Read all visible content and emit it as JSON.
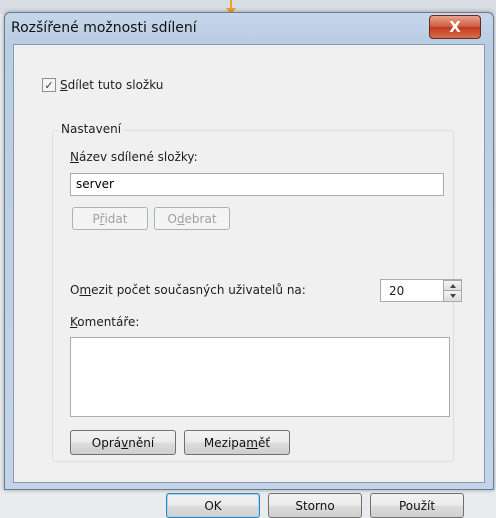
{
  "window": {
    "title": "Rozšířené možnosti sdílení",
    "close_glyph": "X"
  },
  "share_checkbox": {
    "checked": true,
    "check_glyph": "✓",
    "label_mnemonic": "S",
    "label_rest": "dílet tuto složku"
  },
  "settings_group": {
    "legend": "Nastavení",
    "share_name_label_mnemonic": "N",
    "share_name_label_rest": "ázev sdílené složky:",
    "share_name_value": "server",
    "add_button": {
      "before": "P",
      "mnemonic": "ř",
      "after": "idat"
    },
    "remove_button": {
      "before": "O",
      "mnemonic": "d",
      "after": "ebrat"
    },
    "limit_label_before": "O",
    "limit_label_mnemonic": "m",
    "limit_label_after": "ezit počet současných uživatelů na:",
    "limit_value": "20",
    "comments_label_mnemonic": "K",
    "comments_label_rest": "omentáře:",
    "comments_value": "",
    "permissions_button": {
      "before": "Oprá",
      "mnemonic": "v",
      "after": "nění"
    },
    "caching_button": {
      "before": "Mezipa",
      "mnemonic": "m",
      "after": "ěť"
    }
  },
  "footer": {
    "ok_label": "OK",
    "cancel_label": "Storno",
    "apply_label": "Použít"
  },
  "colors": {
    "close_button": "#c7432a",
    "default_button_border": "#3c7fb1",
    "arrow_hint": "#f0a030"
  }
}
